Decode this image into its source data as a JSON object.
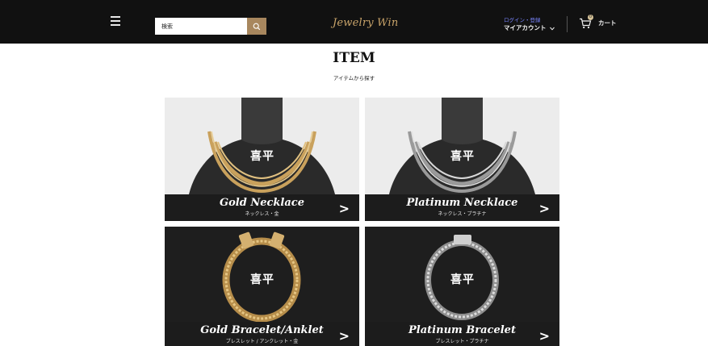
{
  "header": {
    "search_placeholder": "検索",
    "logo": "Jewelry Win",
    "login_label": "ログイン・登録",
    "account_label": "マイアカウント",
    "cart_label": "カート",
    "cart_count": "0"
  },
  "page": {
    "title": "ITEM",
    "subtitle": "アイテムから探す"
  },
  "cards": [
    {
      "name": "Gold Necklace",
      "sub": "ネックレス・金",
      "badge": "喜平",
      "metal": "gold",
      "kind": "necklace"
    },
    {
      "name": "Platinum Necklace",
      "sub": "ネックレス・プラチナ",
      "badge": "喜平",
      "metal": "platinum",
      "kind": "necklace"
    },
    {
      "name": "Gold Bracelet/Anklet",
      "sub": "ブレスレット / アンクレット・金",
      "badge": "喜平",
      "metal": "gold",
      "kind": "bracelet"
    },
    {
      "name": "Platinum Bracelet",
      "sub": "ブレスレット・プラチナ",
      "badge": "喜平",
      "metal": "platinum",
      "kind": "bracelet"
    }
  ],
  "colors": {
    "header_bg": "#111111",
    "accent_gold": "#a8875e",
    "logo": "#c9a46a",
    "login_link": "#7a86ff"
  },
  "icons": [
    "hamburger-menu-icon",
    "search-icon",
    "chevron-down-icon",
    "cart-icon",
    "chevron-right-icon"
  ]
}
